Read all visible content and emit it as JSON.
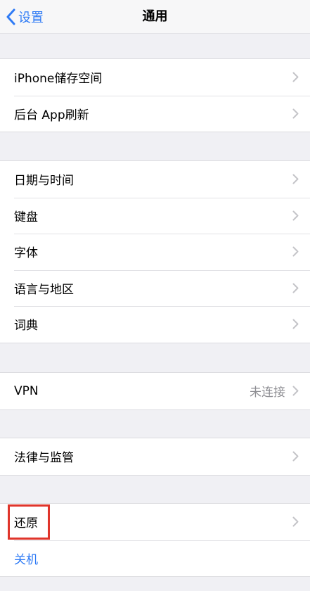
{
  "navbar": {
    "back_label": "设置",
    "title": "通用"
  },
  "groups": [
    {
      "items": [
        {
          "label": "iPhone储存空间"
        },
        {
          "label": "后台 App刷新"
        }
      ]
    },
    {
      "items": [
        {
          "label": "日期与时间"
        },
        {
          "label": "键盘"
        },
        {
          "label": "字体"
        },
        {
          "label": "语言与地区"
        },
        {
          "label": "词典"
        }
      ]
    },
    {
      "items": [
        {
          "label": "VPN",
          "value": "未连接"
        }
      ]
    },
    {
      "items": [
        {
          "label": "法律与监管"
        }
      ]
    },
    {
      "items": [
        {
          "label": "还原"
        },
        {
          "label": "关机"
        }
      ]
    }
  ],
  "colors": {
    "accent": "#2f7bf5",
    "background": "#f0f0f4",
    "highlight": "#e0352b"
  },
  "icons": {
    "back": "chevron-left-icon",
    "row": "chevron-right-icon"
  }
}
